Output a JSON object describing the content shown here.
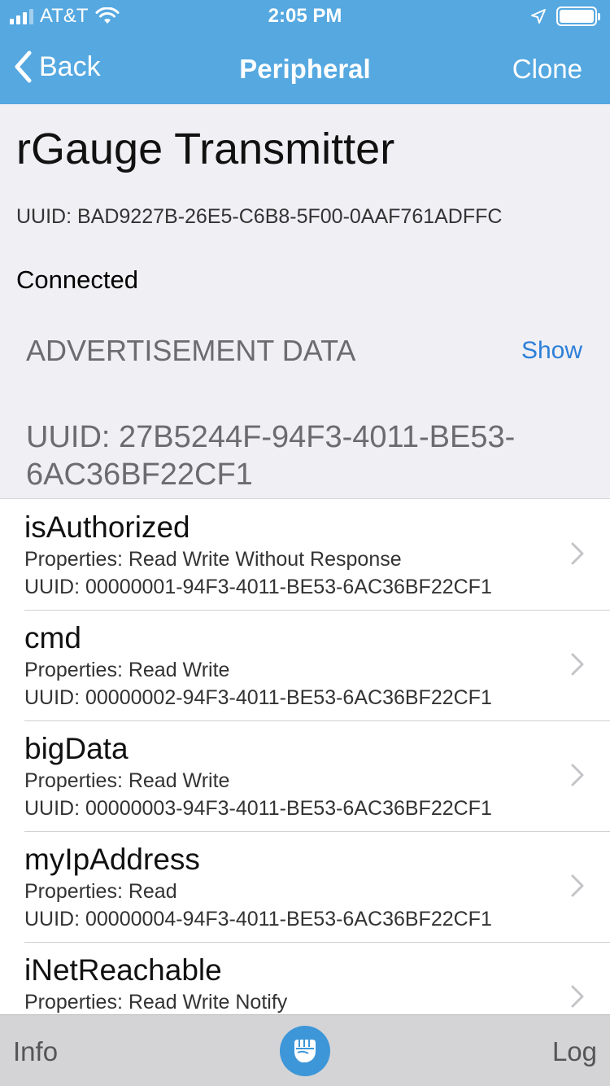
{
  "status_bar": {
    "carrier": "AT&T",
    "time": "2:05 PM",
    "battery_level": 1.0
  },
  "nav": {
    "back_label": "Back",
    "title": "Peripheral",
    "clone_label": "Clone"
  },
  "device": {
    "name": "rGauge Transmitter",
    "uuid": "UUID: BAD9227B-26E5-C6B8-5F00-0AAF761ADFFC",
    "status": "Connected"
  },
  "advertisement": {
    "header": "ADVERTISEMENT DATA",
    "show_label": "Show"
  },
  "service": {
    "uuid": "UUID: 27B5244F-94F3-4011-BE53-6AC36BF22CF1"
  },
  "characteristics": [
    {
      "name": "isAuthorized",
      "properties": "Properties: Read Write Without Response",
      "uuid": "UUID: 00000001-94F3-4011-BE53-6AC36BF22CF1"
    },
    {
      "name": "cmd",
      "properties": "Properties: Read Write",
      "uuid": "UUID: 00000002-94F3-4011-BE53-6AC36BF22CF1"
    },
    {
      "name": "bigData",
      "properties": "Properties: Read Write",
      "uuid": "UUID: 00000003-94F3-4011-BE53-6AC36BF22CF1"
    },
    {
      "name": "myIpAddress",
      "properties": "Properties: Read",
      "uuid": "UUID: 00000004-94F3-4011-BE53-6AC36BF22CF1"
    },
    {
      "name": "iNetReachable",
      "properties": "Properties: Read Write Notify",
      "uuid": ""
    }
  ],
  "tab_bar": {
    "info_label": "Info",
    "log_label": "Log",
    "center_icon": "fist-icon"
  },
  "colors": {
    "nav_blue": "#55a8e0",
    "link_blue": "#2d7fd8",
    "tab_icon_blue": "#3d96d8"
  }
}
